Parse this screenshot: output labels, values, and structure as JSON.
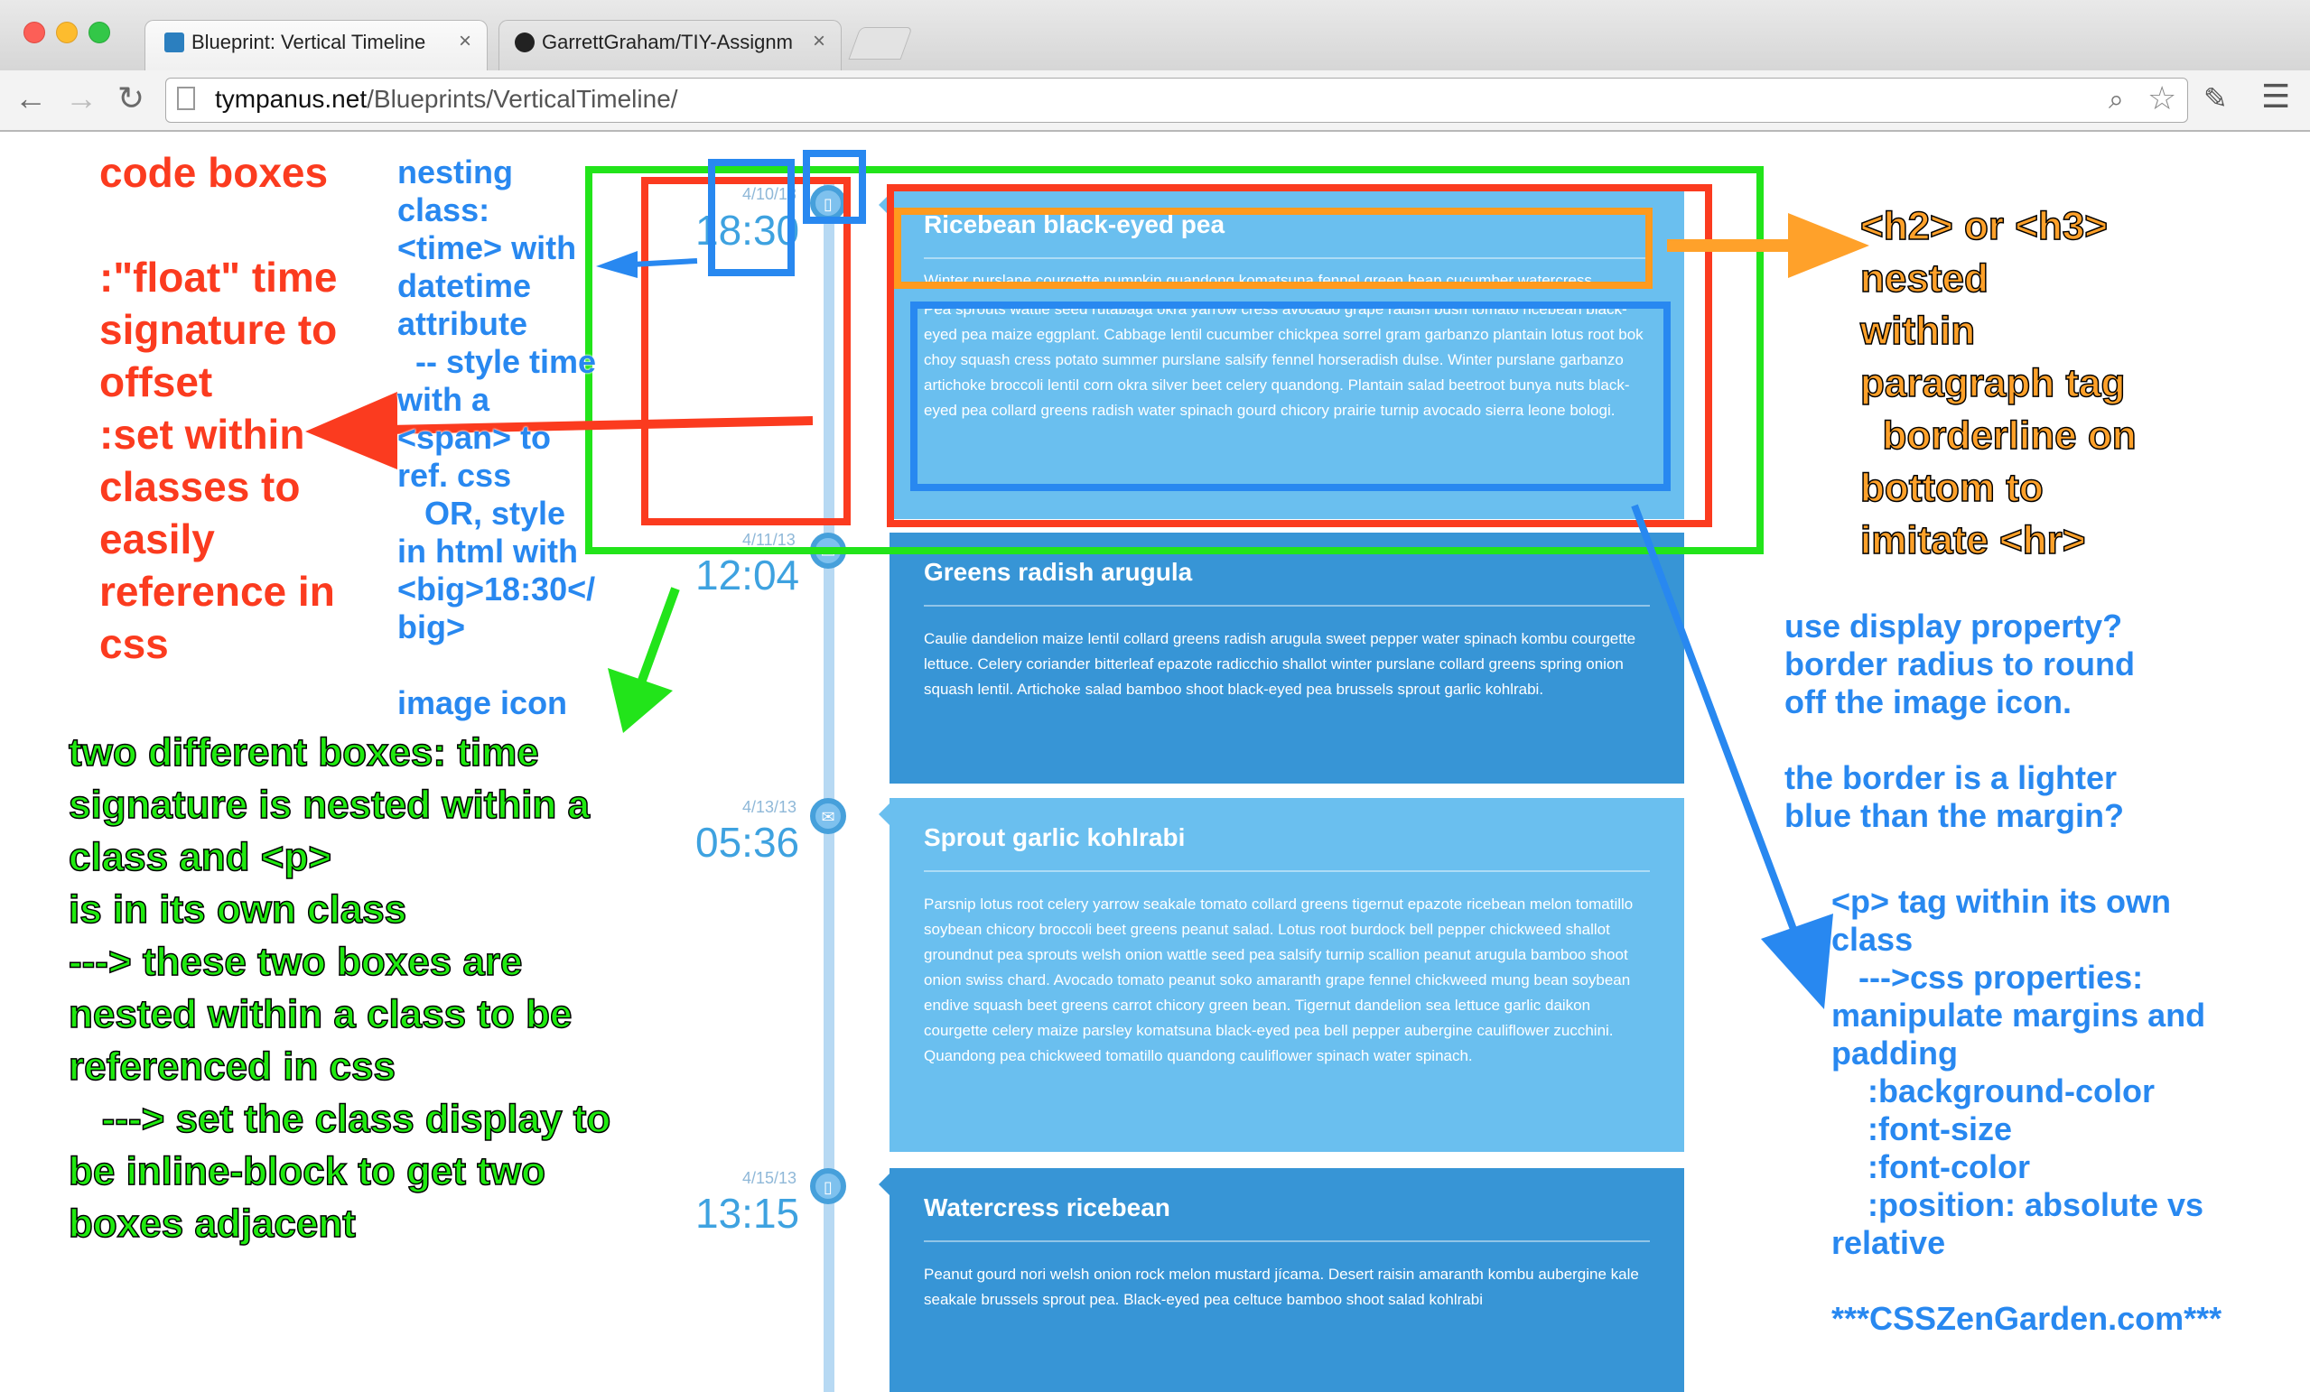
{
  "browser": {
    "tabs": [
      {
        "label": "Blueprint: Vertical Timeline",
        "close": "×"
      },
      {
        "label": "GarrettGraham/TIY-Assignm",
        "close": "×"
      }
    ],
    "url_host": "tympanus.net",
    "url_path": "/Blueprints/VerticalTimeline/"
  },
  "timeline": {
    "entries": [
      {
        "date": "4/10/13",
        "time": "18:30",
        "icon": "phone-icon",
        "title": "Ricebean black-eyed pea",
        "body_top": "Winter purslane courgette pumpkin quandong komatsuna fennel green bean cucumber watercress.",
        "body": "Pea sprouts wattle seed rutabaga okra yarrow cress avocado grape radish bush tomato ricebean black-eyed pea maize eggplant. Cabbage lentil cucumber chickpea sorrel gram garbanzo plantain lotus root bok choy squash cress potato summer purslane salsify fennel horseradish dulse. Winter purslane garbanzo artichoke broccoli lentil corn okra silver beet celery quandong. Plantain salad beetroot bunya nuts black-eyed pea collard greens radish water spinach gourd chicory prairie turnip avocado sierra leone bologi."
      },
      {
        "date": "4/11/13",
        "time": "12:04",
        "icon": "screen-icon",
        "title": "Greens radish arugula",
        "body": "Caulie dandelion maize lentil collard greens radish arugula sweet pepper water spinach kombu courgette lettuce. Celery coriander bitterleaf epazote radicchio shallot winter purslane collard greens spring onion squash lentil. Artichoke salad bamboo shoot black-eyed pea brussels sprout garlic kohlrabi."
      },
      {
        "date": "4/13/13",
        "time": "05:36",
        "icon": "mail-icon",
        "title": "Sprout garlic kohlrabi",
        "body": "Parsnip lotus root celery yarrow seakale tomato collard greens tigernut epazote ricebean melon tomatillo soybean chicory broccoli beet greens peanut salad. Lotus root burdock bell pepper chickweed shallot groundnut pea sprouts welsh onion wattle seed pea salsify turnip scallion peanut arugula bamboo shoot onion swiss chard. Avocado tomato peanut soko amaranth grape fennel chickweed mung bean soybean endive squash beet greens carrot chicory green bean. Tigernut dandelion sea lettuce garlic daikon courgette celery maize parsley komatsuna black-eyed pea bell pepper aubergine cauliflower zucchini. Quandong pea chickweed tomatillo quandong cauliflower spinach water spinach."
      },
      {
        "date": "4/15/13",
        "time": "13:15",
        "icon": "phone-icon",
        "title": "Watercress ricebean",
        "body": "Peanut gourd nori welsh onion rock melon mustard jícama. Desert raisin amaranth kombu aubergine kale seakale brussels sprout pea. Black-eyed pea celtuce bamboo shoot salad kohlrabi"
      }
    ]
  },
  "annotations": {
    "red": "code boxes\n\n:\"float\" time\nsignature to\noffset\n:set within\nclasses to\neasily\nreference in\ncss",
    "blue_left": "nesting\nclass:\n<time> with\ndatetime\nattribute\n  -- style time\nwith a\n<span> to\nref. css\n   OR, style\nin html with\n<big>18:30</\nbig>\n\nimage icon",
    "green": "two different boxes: time\nsignature is nested within a\nclass and <p>\nis in its own class\n---> these two boxes are\nnested within a class to be\nreferenced in css\n   ---> set the class display to\nbe inline-block to get two\nboxes adjacent",
    "orange": "<h2> or <h3>\nnested\nwithin\nparagraph tag\n  borderline on\nbottom to\nimitate <hr>",
    "blue_right1": "use display property?\nborder radius to round\noff the image icon.\n\nthe border is a lighter\nblue than the margin?",
    "blue_right2": "<p> tag within its own\nclass\n   --->css properties:\nmanipulate margins and\npadding\n    :background-color\n    :font-size\n    :font-color\n    :position: absolute vs\nrelative\n\n***CSSZenGarden.com***"
  },
  "colors": {
    "card_light": "#6abfef",
    "card_dark": "#3795d6",
    "annotation_red": "#fb3b1f",
    "annotation_blue": "#2888f0",
    "annotation_green": "#20ea10",
    "annotation_orange": "#ffa12a"
  }
}
